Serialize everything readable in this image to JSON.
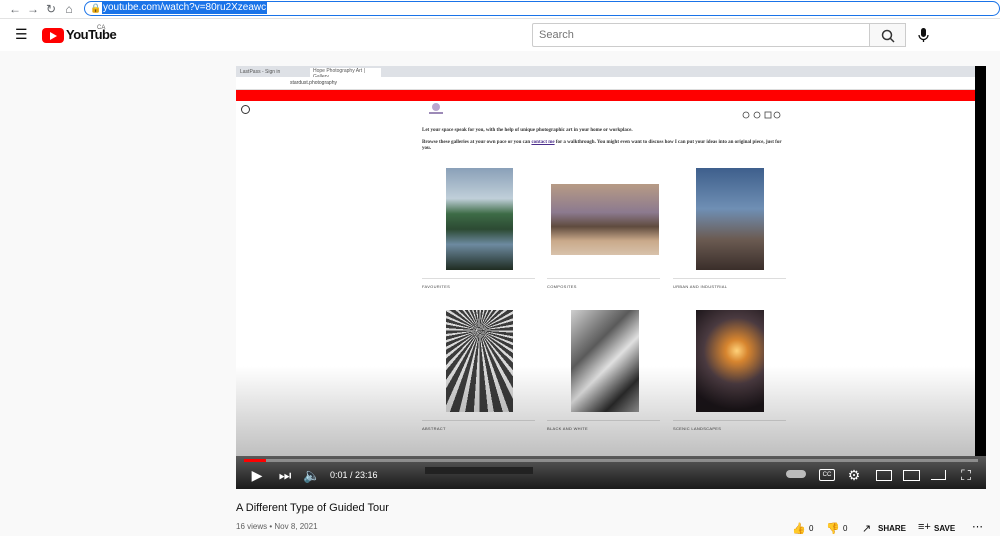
{
  "browser": {
    "url": "youtube.com/watch?v=80ru2Xzeawc"
  },
  "header": {
    "logo_text": "YouTube",
    "region": "CA",
    "search_placeholder": "Search"
  },
  "inner_site": {
    "tabs": [
      "LastPass - Sign in",
      "Hope Photography Art | Gallery"
    ],
    "url": "stardust.photography",
    "intro_1": "Let your space speak for you, with the help of unique photographic art in your home or workplace.",
    "intro_2a": "Browse these galleries at your own pace or you can ",
    "intro_link": "contact me",
    "intro_2b": " for a walkthrough. You might even want to discuss how I can put your ideas into an original piece, just for you.",
    "galleries": [
      "FAVOURITES",
      "COMPOSITES",
      "URBAN AND INDUSTRIAL",
      "ABSTRACT",
      "BLACK AND WHITE",
      "SCENIC LANDSCAPES"
    ]
  },
  "player": {
    "time": "0:01 / 23:16",
    "progress": 0.03
  },
  "video": {
    "title": "A Different Type of Guided Tour",
    "meta": "16 views • Nov 8, 2021",
    "likes": "0",
    "dislikes": "0",
    "share_label": "SHARE",
    "save_label": "SAVE"
  },
  "colors": {
    "youtube_red": "#ff0000",
    "url_highlight": "#1a73e8",
    "promo_banner": "#ff0000"
  }
}
